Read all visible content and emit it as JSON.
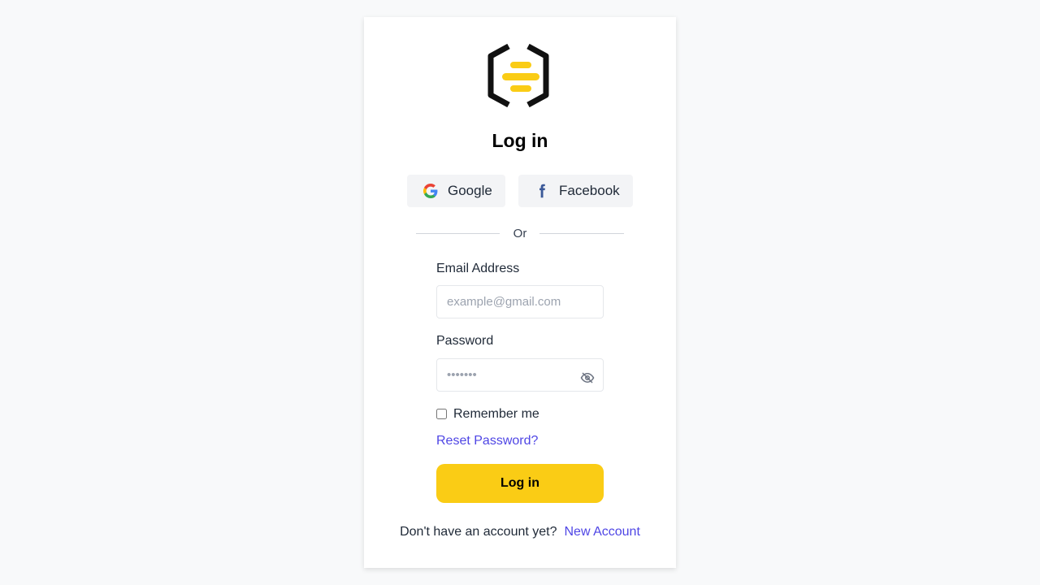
{
  "title": "Log in",
  "social": {
    "google_label": "Google",
    "facebook_label": "Facebook"
  },
  "divider_text": "Or",
  "email": {
    "label": "Email Address",
    "placeholder": "example@gmail.com"
  },
  "password": {
    "label": "Password",
    "placeholder": "•••••••"
  },
  "remember_label": "Remember me",
  "reset_link": "Reset Password?",
  "login_button": "Log in",
  "footer": {
    "prompt": "Don't have an account yet?",
    "link": "New Account"
  },
  "icons": {
    "logo": "hexagon-logo-icon",
    "google": "google-icon",
    "facebook": "facebook-icon",
    "eye": "eye-off-icon"
  },
  "colors": {
    "accent": "#facc15",
    "link": "#4f46e5",
    "facebook": "#3b5998"
  }
}
